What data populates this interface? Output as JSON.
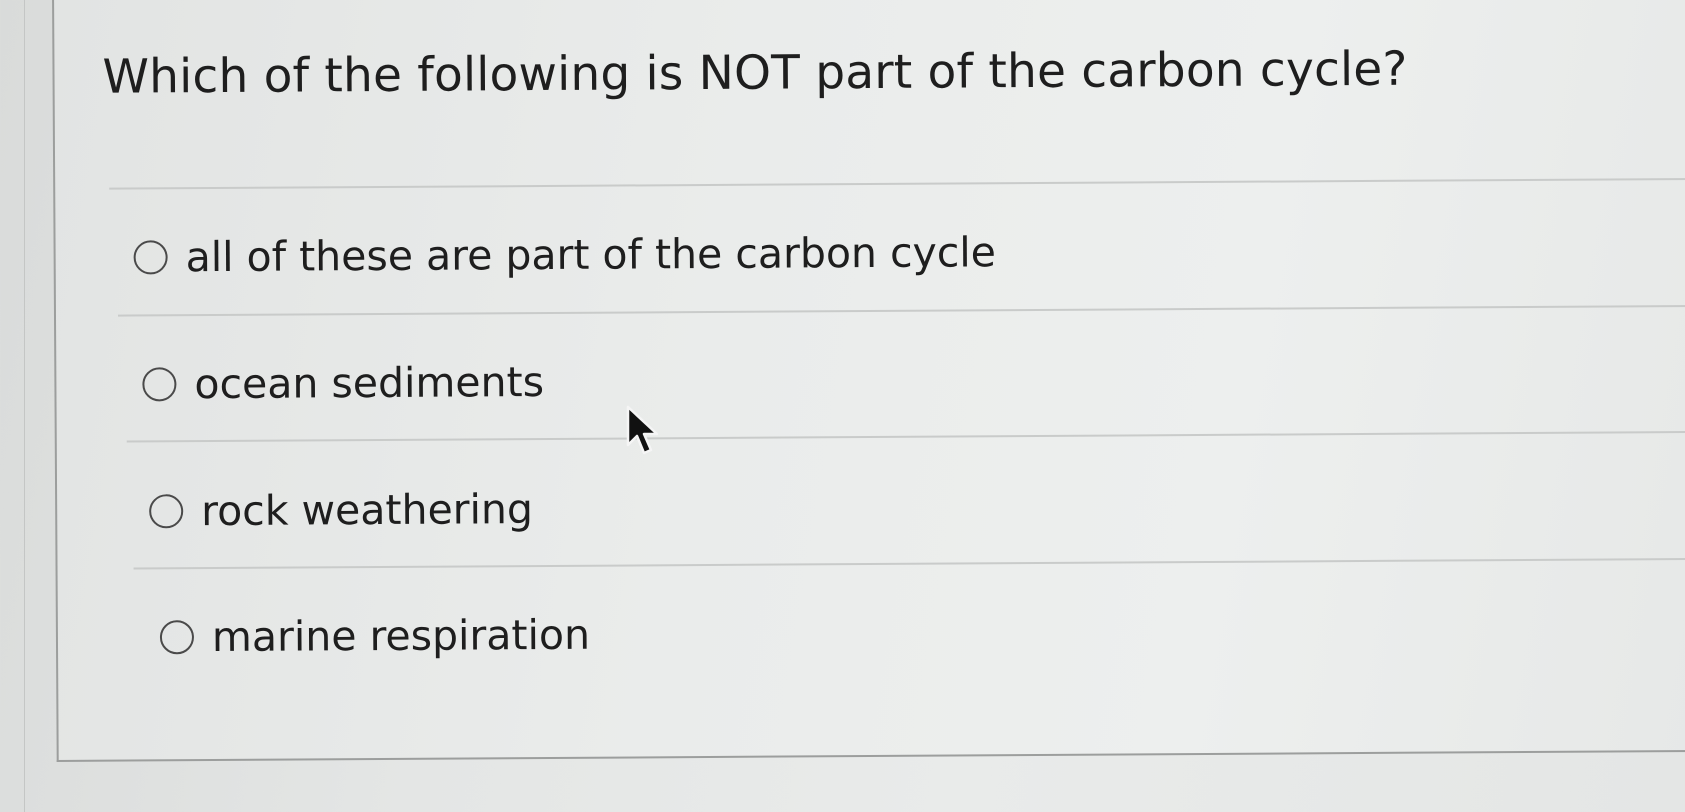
{
  "question": {
    "text": "Which of the following is NOT part of the carbon cycle?"
  },
  "answers": [
    {
      "label": "all of these are part of the carbon cycle",
      "selected": false
    },
    {
      "label": "ocean sediments",
      "selected": false
    },
    {
      "label": "rock weathering",
      "selected": false
    },
    {
      "label": "marine respiration",
      "selected": false
    }
  ],
  "cursor": {
    "icon": "mouse-pointer-icon"
  }
}
